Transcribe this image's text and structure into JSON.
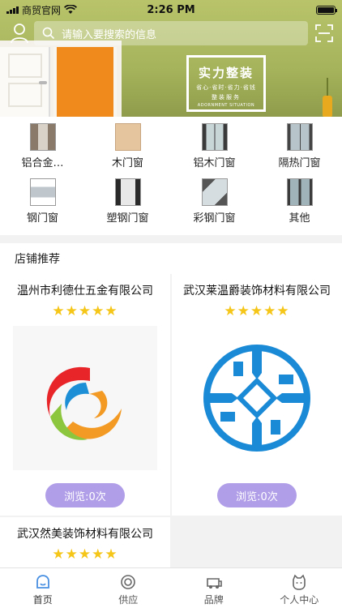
{
  "status_bar": {
    "carrier": "商贸官网",
    "time": "2:26 PM",
    "battery": 1.0
  },
  "search": {
    "placeholder": "请输入要搜索的信息"
  },
  "banner": {
    "title": "实力整装",
    "line1": "省心·省时·省力·省钱",
    "line2": "整装服务",
    "line3": "ADORNMENT SITUATION"
  },
  "categories": [
    {
      "label": "铝合金…",
      "icon": "aluminum-door-thumb"
    },
    {
      "label": "木门窗",
      "icon": "wood-door-thumb"
    },
    {
      "label": "铝木门窗",
      "icon": "aluminum-wood-door-thumb"
    },
    {
      "label": "隔热门窗",
      "icon": "thermal-door-thumb"
    },
    {
      "label": "钢门窗",
      "icon": "steel-door-thumb"
    },
    {
      "label": "塑钢门窗",
      "icon": "plastic-steel-door-thumb"
    },
    {
      "label": "彩钢门窗",
      "icon": "color-steel-door-thumb"
    },
    {
      "label": "其他",
      "icon": "other-door-thumb"
    }
  ],
  "shops": {
    "heading": "店铺推荐",
    "items": [
      {
        "name": "温州市利德仕五金有限公司",
        "stars": "★★★★★",
        "rating": 5,
        "views_label": "浏览:0次"
      },
      {
        "name": "武汉莱温爵装饰材料有限公司",
        "stars": "★★★★★",
        "rating": 5,
        "views_label": "浏览:0次"
      },
      {
        "name": "武汉然美装饰材料有限公司",
        "stars": "★★★★★",
        "rating": 5
      }
    ]
  },
  "tabs": [
    {
      "label": "首页",
      "icon": "home-icon",
      "active": true
    },
    {
      "label": "供应",
      "icon": "supply-icon",
      "active": false
    },
    {
      "label": "品牌",
      "icon": "brand-icon",
      "active": false
    },
    {
      "label": "个人中心",
      "icon": "profile-icon",
      "active": false
    }
  ],
  "colors": {
    "accent": "#b19ee8",
    "star": "#f5c518",
    "active_tab": "#4a90e2"
  }
}
